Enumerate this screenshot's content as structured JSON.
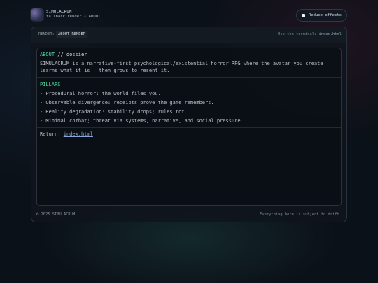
{
  "header": {
    "brand_name": "SIMULACRUM",
    "brand_sub": "fallback render • ABOUT",
    "reduce_effects_label": "Reduce effects"
  },
  "panel": {
    "render_label": "RENDER:",
    "render_value": "ABOUT-RENDER",
    "terminal_hint_prefix": "Use the terminal:",
    "terminal_link": "index.html"
  },
  "content": {
    "heading_accent": "ABOUT",
    "heading_rest": "// dossier",
    "description": "SIMULACRUM is a narrative-first psychological/existential horror RPG where the avatar you create learns what it is — then grows to resent it.",
    "pillars_title": "PILLARS",
    "pillars": [
      "- Procedural horror: the world files you.",
      "- Observable divergence: receipts prove the game remembers.",
      "- Reality degradation: stability drops; rules rot.",
      "- Minimal combat; threat via systems, narrative, and social pressure."
    ],
    "return_prefix": "Return:",
    "return_link": "index.html"
  },
  "footer": {
    "copyright": "© 2025 SIMULACRUM",
    "drift_note": "Everything here is subject to drift."
  }
}
